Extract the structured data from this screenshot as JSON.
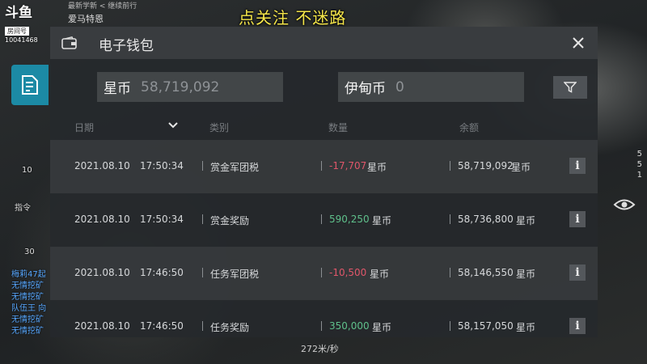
{
  "overlay": {
    "caption": "点关注 不迷路",
    "stream_brand": "斗鱼",
    "room_tag": "房间号",
    "room_id": "10041468",
    "player_header": "最新学新 < 继续前行",
    "player_name": "爱马特恩"
  },
  "hud": {
    "left_numbers": [
      "10",
      "30"
    ],
    "command_label": "指令",
    "chat_lines": [
      "梅莉47起",
      "无情挖矿",
      "无情挖矿",
      "队伍王 向",
      "无情挖矿",
      "无情挖矿"
    ],
    "right_counts": [
      "5",
      "5",
      "1"
    ],
    "speed": "272米/秒"
  },
  "wallet": {
    "title": "电子钱包",
    "star_coin_label": "星币",
    "star_coin_balance": "58,719,092",
    "ion_coin_label": "伊甸币",
    "ion_coin_balance": "0",
    "columns": {
      "date": "日期",
      "category": "类别",
      "amount": "数量",
      "balance": "余额"
    },
    "rows": [
      {
        "date": "2021.08.10",
        "time": "17:50:34",
        "category": "赏金军团税",
        "amount": "-17,707",
        "amount_type": "neg",
        "unit": "星币",
        "balance": "58,719,092",
        "balance_unit": "星币"
      },
      {
        "date": "2021.08.10",
        "time": "17:50:34",
        "category": "赏金奖励",
        "amount": "590,250",
        "amount_type": "pos",
        "unit": "星币",
        "balance": "58,736,800",
        "balance_unit": "星币"
      },
      {
        "date": "2021.08.10",
        "time": "17:46:50",
        "category": "任务军团税",
        "amount": "-10,500",
        "amount_type": "neg",
        "unit": "星币",
        "balance": "58,146,550",
        "balance_unit": "星币"
      },
      {
        "date": "2021.08.10",
        "time": "17:46:50",
        "category": "任务奖励",
        "amount": "350,000",
        "amount_type": "pos",
        "unit": "星币",
        "balance": "58,157,050",
        "balance_unit": "星币"
      }
    ],
    "info_symbol": "i"
  },
  "colors": {
    "accent": "#1c8aa5",
    "negative": "#e0566a",
    "positive": "#5fc08b",
    "caption": "#f5e64a"
  },
  "icons": [
    "wallet-icon",
    "close-icon",
    "filter-icon",
    "chevron-down-icon",
    "info-icon",
    "document-icon",
    "eye-icon"
  ]
}
